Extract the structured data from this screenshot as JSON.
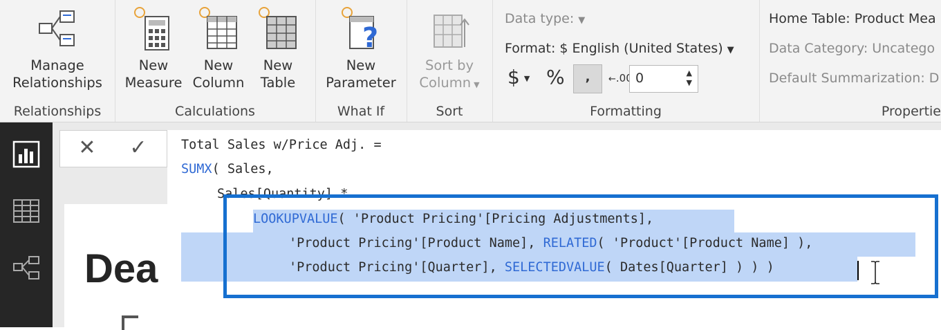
{
  "ribbon": {
    "groups": {
      "relationships": {
        "label": "Relationships",
        "manage_label_1": "Manage",
        "manage_label_2": "Relationships"
      },
      "calculations": {
        "label": "Calculations",
        "new_measure_1": "New",
        "new_measure_2": "Measure",
        "new_column_1": "New",
        "new_column_2": "Column",
        "new_table_1": "New",
        "new_table_2": "Table"
      },
      "what_if": {
        "label": "What If",
        "new_parameter_1": "New",
        "new_parameter_2": "Parameter"
      },
      "sort": {
        "label": "Sort",
        "sort_by_1": "Sort by",
        "sort_by_2": "Column"
      },
      "formatting": {
        "label": "Formatting",
        "data_type": "Data type:",
        "format": "Format: $ English (United States)",
        "currency_symbol": "$",
        "percent_symbol": "%",
        "comma_symbol": ",",
        "decimal_symbol": ".00",
        "decimal_value": "0"
      },
      "properties": {
        "label": "Propertie",
        "home_table": "Home Table: Product Mea",
        "data_category": "Data Category: Uncatego",
        "default_summarization": "Default Summarization: D"
      }
    }
  },
  "left_nav": {
    "items": [
      "report-view-icon",
      "data-view-icon",
      "model-view-icon"
    ]
  },
  "canvas": {
    "title_fragment": "Dea"
  },
  "formula_bar": {
    "cancel_symbol": "✕",
    "commit_symbol": "✓",
    "lines": {
      "l1": "Total Sales w/Price Adj. =",
      "l2_fn": "SUMX",
      "l2_rest": "( Sales,",
      "l3": "Sales[Quantity] *",
      "l4_fn": "LOOKUPVALUE",
      "l4_rest": "( 'Product Pricing'[Pricing Adjustments],",
      "l5_a": "'Product Pricing'[Product Name], ",
      "l5_fn": "RELATED",
      "l5_b": "( 'Product'[Product Name] ),",
      "l6_a": "'Product Pricing'[Quarter], ",
      "l6_fn": "SELECTEDVALUE",
      "l6_b": "( Dates[Quarter] ) ) )"
    }
  },
  "colors": {
    "highlight_border": "#1670d0",
    "selection": "#bfd6f7",
    "function": "#2f69d4",
    "nav_bg": "#262626"
  }
}
